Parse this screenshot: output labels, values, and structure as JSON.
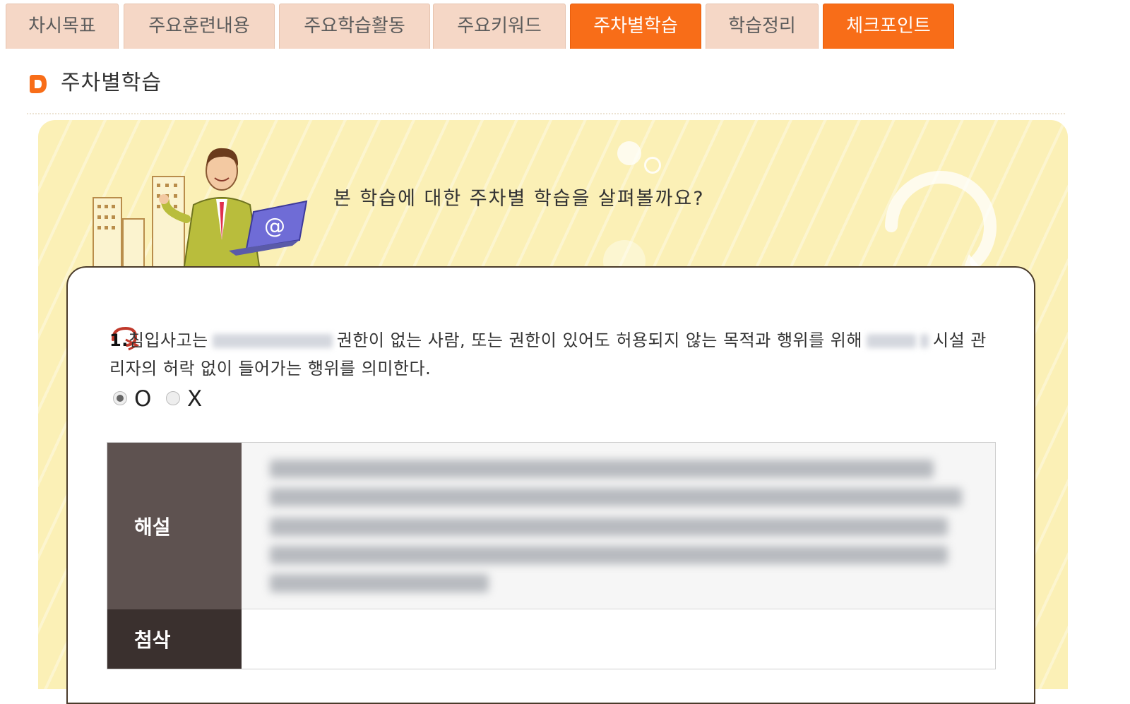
{
  "tabs": [
    {
      "label": "차시목표",
      "active": false
    },
    {
      "label": "주요훈련내용",
      "active": false
    },
    {
      "label": "주요학습활동",
      "active": false
    },
    {
      "label": "주요키워드",
      "active": false
    },
    {
      "label": "주차별학습",
      "active": true
    },
    {
      "label": "학습정리",
      "active": false
    },
    {
      "label": "체크포인트",
      "active": true
    }
  ],
  "section": {
    "title": "주차별학습",
    "icon": "orange-bullet-icon"
  },
  "banner": {
    "text": "본 학습에 대한 주차별 학습을 살펴볼까요?"
  },
  "quiz": {
    "number": "1.",
    "text_part1": "침입사고는",
    "text_part2": "권한이 없는 사람, 또는 권한이 있어도 허용되지 않는 목적과 행위를 위해",
    "text_part3": "시설 관리자의 허락 없이 들어가는 행위를 의미한다.",
    "options": [
      {
        "label": "O",
        "selected": true
      },
      {
        "label": "X",
        "selected": false
      }
    ]
  },
  "explanation": {
    "header": "해설"
  },
  "correction": {
    "header": "첨삭",
    "body": ""
  },
  "colors": {
    "accent": "#f86d18",
    "tab_inactive": "#f5d7c6",
    "banner": "#fbf0b6",
    "header_dark": "#5e5250"
  }
}
